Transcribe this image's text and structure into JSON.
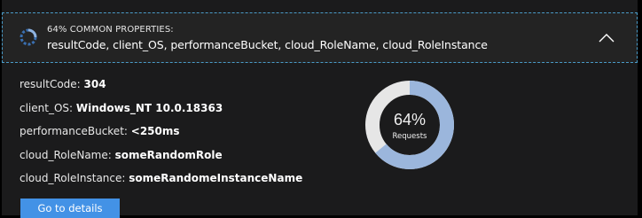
{
  "header": {
    "summary_line": "64% COMMON PROPERTIES:",
    "properties_line": "resultCode, client_OS, performanceBucket, cloud_RoleName, cloud_RoleInstance",
    "spinner_icon": "progress-spinner-icon",
    "collapse_icon": "chevron-up-icon"
  },
  "properties": [
    {
      "label": "resultCode:",
      "value": "304"
    },
    {
      "label": "client_OS:",
      "value": "Windows_NT 10.0.18363"
    },
    {
      "label": "performanceBucket:",
      "value": "<250ms"
    },
    {
      "label": "cloud_RoleName:",
      "value": "someRandomRole"
    },
    {
      "label": "cloud_RoleInstance:",
      "value": "someRandomeInstanceName"
    }
  ],
  "donut": {
    "percent_label": "64%",
    "sub_label": "Requests",
    "fraction": 0.64,
    "fill_color": "#9bb6dc",
    "track_color": "#e6e6e6"
  },
  "actions": {
    "details_label": "Go to details"
  },
  "colors": {
    "accent": "#4392e6",
    "header_border": "#4a9cc9"
  }
}
